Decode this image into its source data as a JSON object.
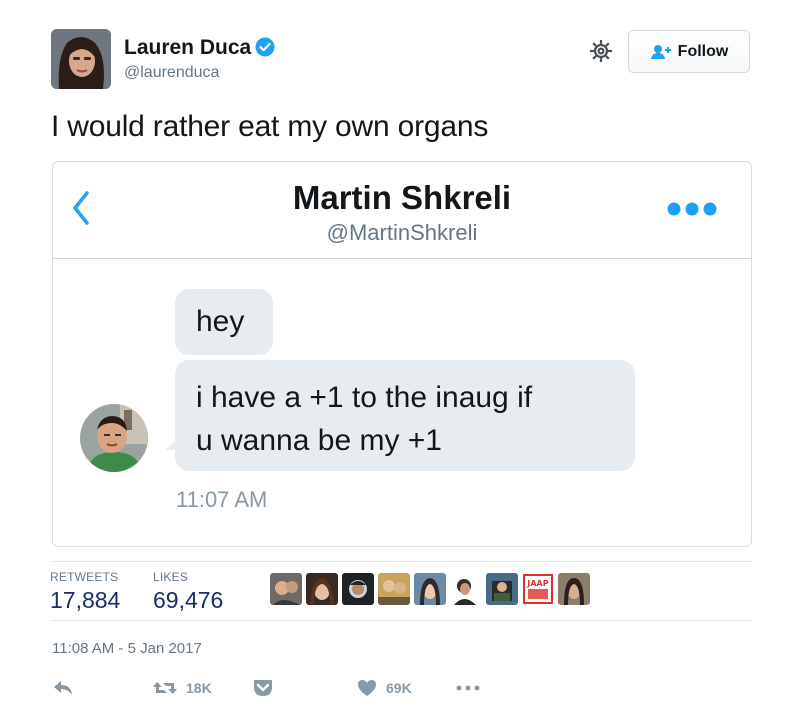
{
  "author": {
    "name": "Lauren Duca",
    "handle": "@laurenduca",
    "verified": true
  },
  "follow_label": "Follow",
  "tweet_text": "I would rather eat my own organs",
  "dm": {
    "name": "Martin Shkreli",
    "handle": "@MartinShkreli",
    "messages": [
      {
        "text": "hey"
      },
      {
        "line1": "i have a +1 to the inaug if",
        "line2": "u wanna be my +1"
      }
    ],
    "time": "11:07 AM"
  },
  "stats": {
    "retweets_label": "RETWEETS",
    "retweets_value": "17,884",
    "likes_label": "LIKES",
    "likes_value": "69,476"
  },
  "timestamp": "11:08 AM - 5 Jan 2017",
  "actions": {
    "retweet_count": "18K",
    "like_count": "69K"
  },
  "liker_badge_text": "JAAP",
  "colors": {
    "accent": "#1da1f2",
    "stat_value": "#1c2b6e",
    "bubble": "#e6ecf0",
    "muted": "#657786"
  },
  "icons": [
    "verified-badge-icon",
    "gear-icon",
    "follow-person-icon",
    "back-chevron-icon",
    "more-dots-icon",
    "reply-icon",
    "retweet-icon",
    "pocket-icon",
    "heart-icon",
    "more-icon"
  ]
}
